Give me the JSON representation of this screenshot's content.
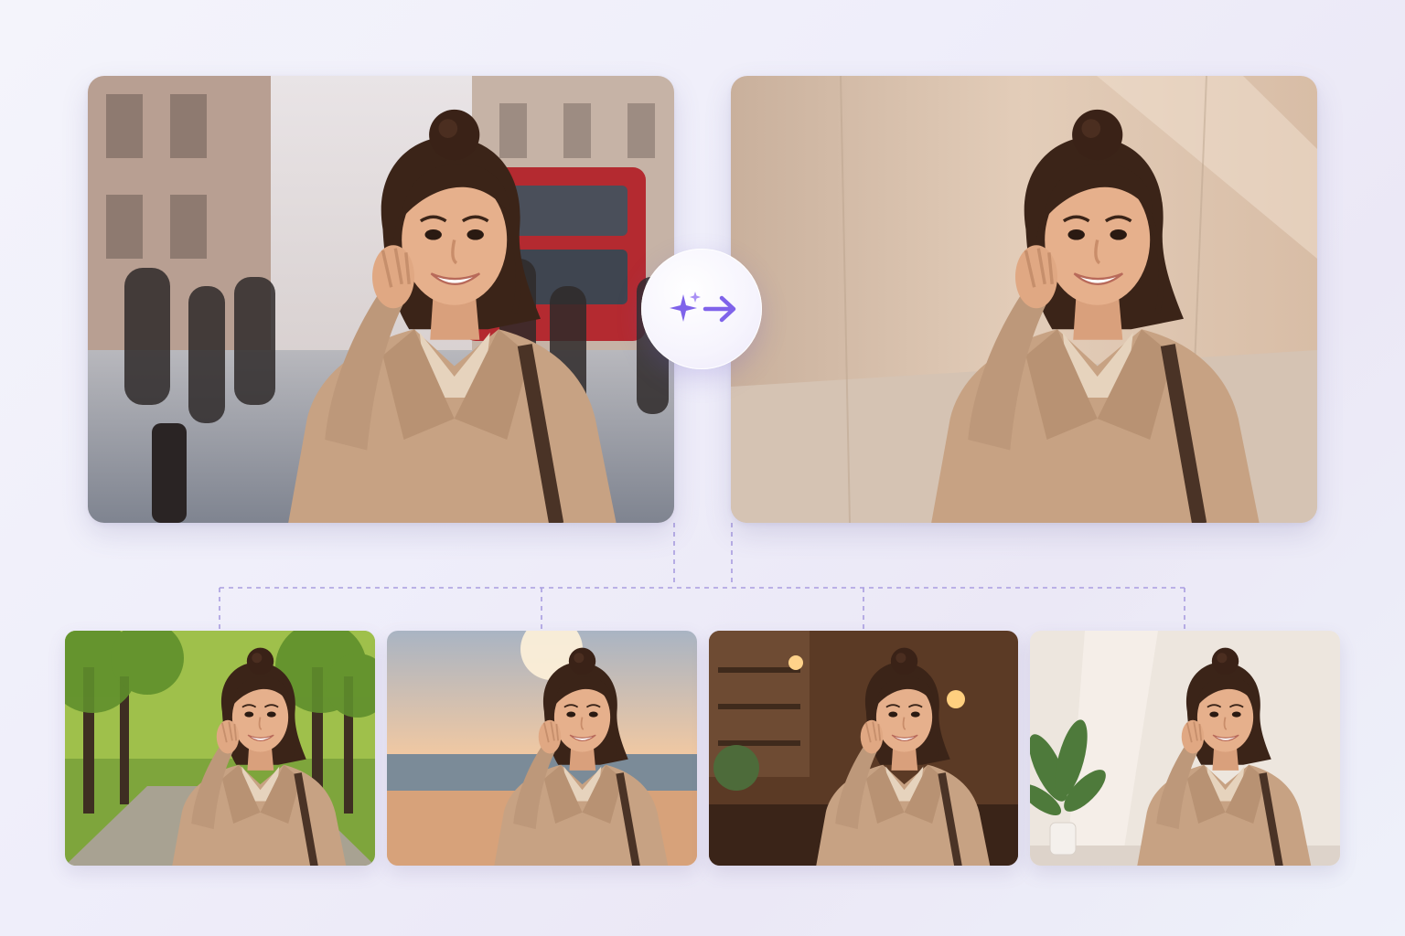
{
  "colors": {
    "accent": "#7f63ea",
    "accent_light": "#a990f5",
    "connector": "#a99de0",
    "background": "#efeefa"
  },
  "main": {
    "original_image": {
      "icon": "portrait-city-street-photo"
    },
    "result_image": {
      "icon": "portrait-plain-wall-photo"
    },
    "transform_button": {
      "icon": "sparkle-arrow-right-icon"
    }
  },
  "variants": [
    {
      "icon": "portrait-park-photo"
    },
    {
      "icon": "portrait-beach-sunset-photo"
    },
    {
      "icon": "portrait-cafe-photo"
    },
    {
      "icon": "portrait-studio-plant-photo"
    }
  ]
}
